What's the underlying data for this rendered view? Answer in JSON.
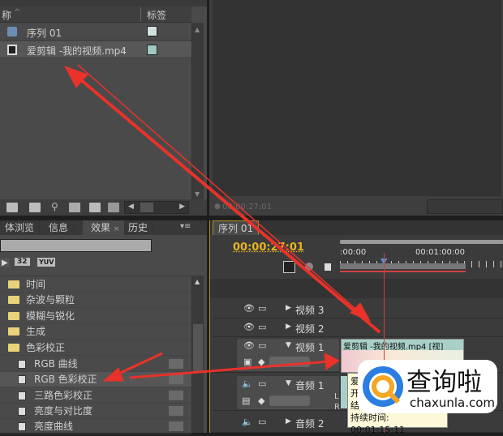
{
  "project": {
    "col_name": "称",
    "col_label": "标签",
    "items": [
      {
        "name": "序列 01",
        "color": "#cfe0df"
      },
      {
        "name": "爱剪辑 -我的视频.mp4",
        "color": "#9fc8c2"
      }
    ]
  },
  "monitor": {
    "timecode": "00:00:27:01"
  },
  "effects": {
    "tabs": [
      "体浏览",
      "信息",
      "效果",
      "历史"
    ],
    "close": "×",
    "badges": [
      "32",
      "YUV"
    ],
    "folders": [
      "时间",
      "杂波与颗粒",
      "模糊与锐化",
      "生成",
      "色彩校正"
    ],
    "items": [
      "RGB 曲线",
      "RGB 色彩校正",
      "三路色彩校正",
      "亮度与对比度",
      "亮度曲线"
    ]
  },
  "timeline": {
    "tab": "序列 01",
    "timecode": "00:00:27:01",
    "ruler": [
      ":00:00",
      "00:01:00:00"
    ],
    "tracks": [
      "视频 3",
      "视频 2",
      "视频 1",
      "音频 1",
      "音频 2"
    ],
    "clip": "爱剪辑 -我的视频.mp4 [视]",
    "tooltip": {
      "lines": [
        "爱",
        "开",
        "结"
      ],
      "duration": "持续时间: 00:01:15:11"
    },
    "audio_lr": [
      "L",
      "R"
    ]
  },
  "watermark": {
    "brand": "查询啦",
    "url": "chaxunla.com"
  },
  "colors": {
    "timecode": "#e8b422",
    "arrow": "#e8322a",
    "playhead": "#d04040"
  }
}
